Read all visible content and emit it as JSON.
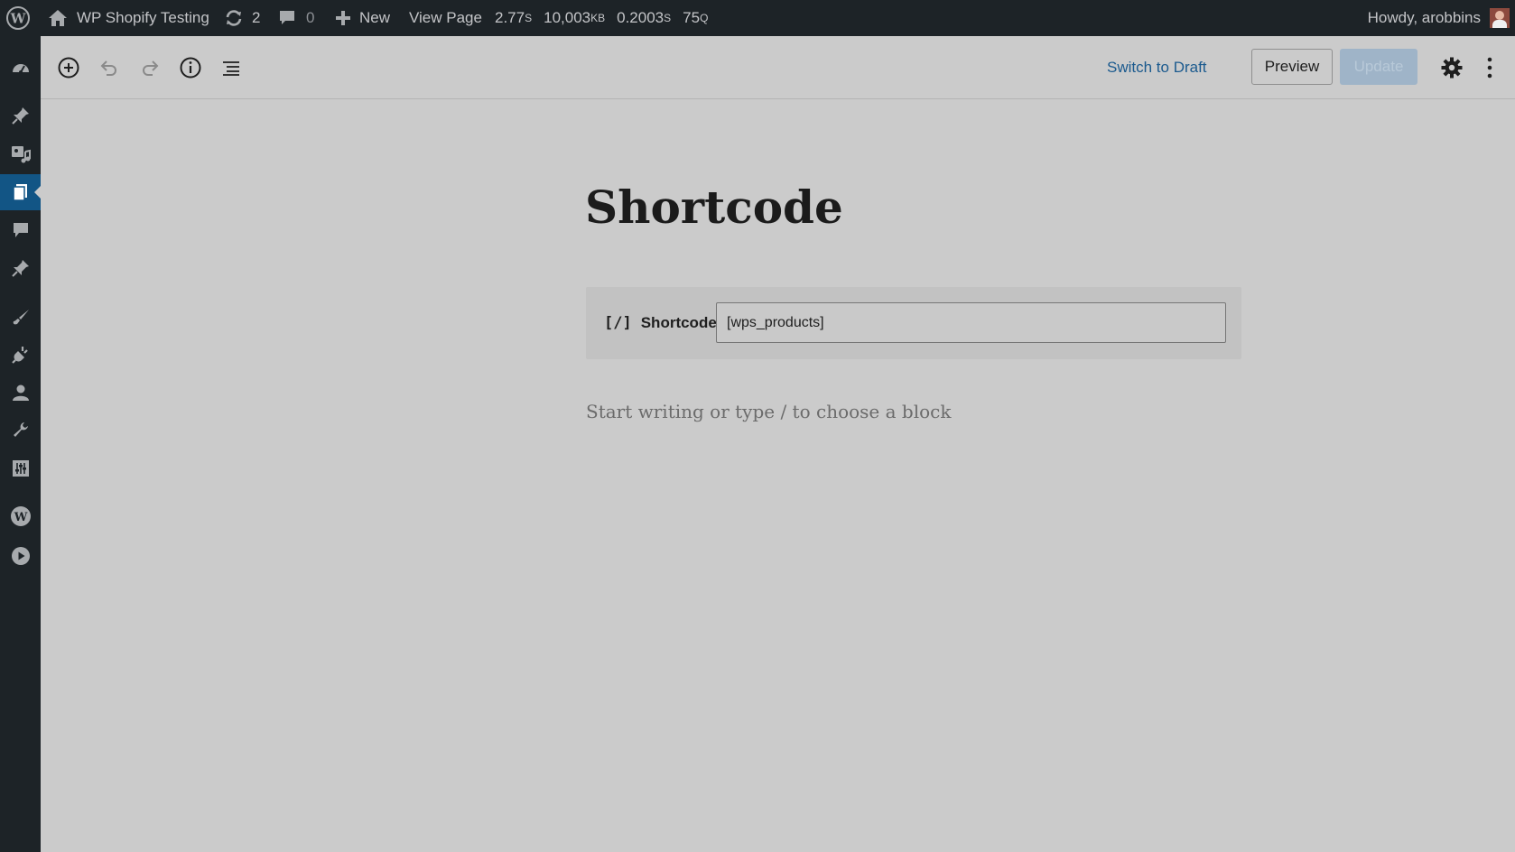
{
  "admin_bar": {
    "site_name": "WP Shopify Testing",
    "updates_count": "2",
    "comments_count": "0",
    "new_label": "New",
    "view_page_label": "View Page",
    "query_time": "2.77",
    "query_time_unit": "S",
    "memory": "10,003",
    "memory_unit": "KB",
    "db_time": "0.2003",
    "db_time_unit": "S",
    "queries": "75",
    "queries_unit": "Q",
    "greeting": "Howdy, arobbins"
  },
  "toolbar": {
    "switch_to_draft": "Switch to Draft",
    "preview": "Preview",
    "update": "Update"
  },
  "editor": {
    "title": "Shortcode",
    "shortcode_block": {
      "icon_text": "[/]",
      "label": "Shortcode",
      "value": "[wps_products]"
    },
    "placeholder": "Start writing or type / to choose a block"
  },
  "colors": {
    "admin_bg": "#1d2327",
    "active_menu": "#125585",
    "link": "#1b5a8e",
    "canvas_bg": "#cbcbcb"
  },
  "sidebar": {
    "icons": [
      "dashboard-icon",
      "posts-icon",
      "media-icon",
      "pages-icon",
      "comments-icon",
      "pin-icon",
      "appearance-icon",
      "plugins-icon",
      "users-icon",
      "tools-icon",
      "settings-icon",
      "wordpress-icon",
      "play-icon"
    ],
    "active": "pages-icon"
  }
}
